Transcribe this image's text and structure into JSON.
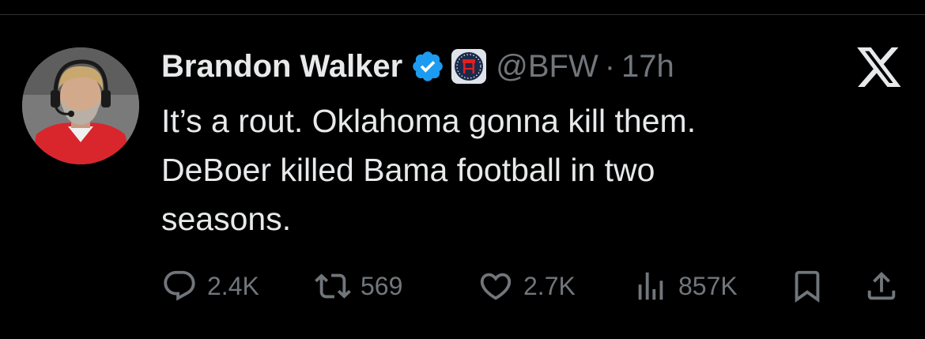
{
  "tweet": {
    "author": {
      "name": "Brandon Walker",
      "handle": "@BFW",
      "verified": true,
      "affiliate_badge": "barstool-badge-icon"
    },
    "separator": "·",
    "time": "17h",
    "text_lines": [
      "It’s a rout. Oklahoma gonna kill them.",
      "DeBoer killed Bama football in two",
      "seasons."
    ],
    "metrics": {
      "replies": "2.4K",
      "reposts": "569",
      "likes": "2.7K",
      "views": "857K"
    },
    "icons": {
      "reply": "reply-icon",
      "repost": "repost-icon",
      "like": "heart-icon",
      "views": "views-icon",
      "bookmark": "bookmark-icon",
      "share": "share-icon",
      "platform": "x-logo-icon"
    }
  },
  "colors": {
    "background": "#000000",
    "text": "#e7e9ea",
    "muted": "#71767b",
    "verified": "#1d9bf0",
    "badge": "#1b2a4a"
  }
}
